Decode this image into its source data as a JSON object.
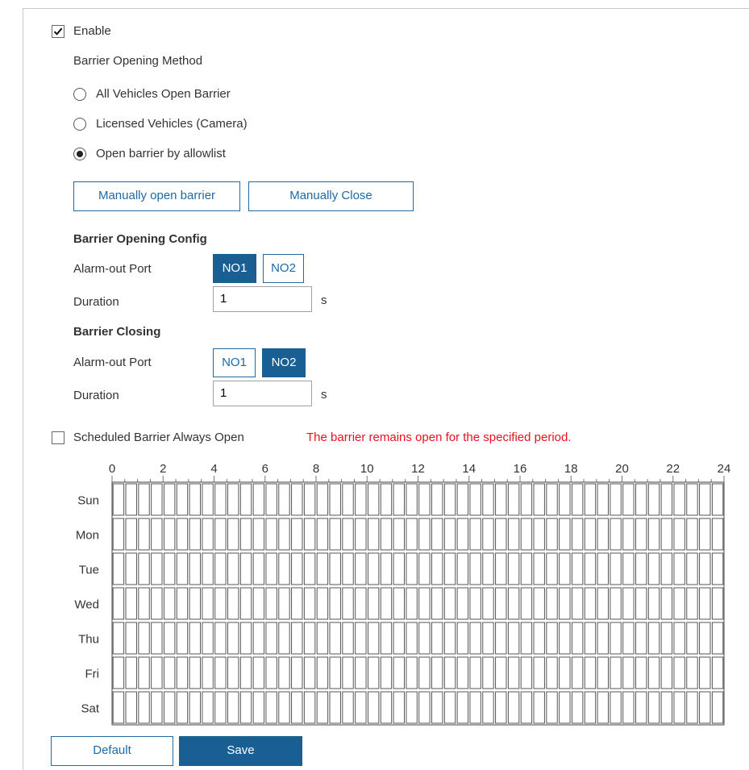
{
  "enable": {
    "label": "Enable",
    "checked": true
  },
  "opening_method": {
    "title": "Barrier Opening Method",
    "options": [
      {
        "label": "All Vehicles Open Barrier",
        "selected": false
      },
      {
        "label": "Licensed Vehicles (Camera)",
        "selected": false
      },
      {
        "label": "Open barrier by allowlist",
        "selected": true
      }
    ]
  },
  "manual_buttons": {
    "open": "Manually open barrier",
    "close": "Manually Close"
  },
  "opening_config": {
    "title": "Barrier Opening Config",
    "port_label": "Alarm-out Port",
    "ports": [
      "NO1",
      "NO2"
    ],
    "active_port": "NO1",
    "duration_label": "Duration",
    "duration_value": "1",
    "duration_unit": "s"
  },
  "closing_config": {
    "title": "Barrier Closing",
    "port_label": "Alarm-out Port",
    "ports": [
      "NO1",
      "NO2"
    ],
    "active_port": "NO2",
    "duration_label": "Duration",
    "duration_value": "1",
    "duration_unit": "s"
  },
  "schedule": {
    "label": "Scheduled Barrier Always Open",
    "checked": false,
    "note": "The barrier remains open for the specified period.",
    "hour_labels": [
      "0",
      "2",
      "4",
      "6",
      "8",
      "10",
      "12",
      "14",
      "16",
      "18",
      "20",
      "22",
      "24"
    ],
    "days": [
      "Sun",
      "Mon",
      "Tue",
      "Wed",
      "Thu",
      "Fri",
      "Sat"
    ],
    "slots_per_day": 48
  },
  "footer": {
    "default_label": "Default",
    "save_label": "Save"
  },
  "colors": {
    "accent": "#1a5f94",
    "warning": "#e8121e",
    "grid_line": "#c8c8c8"
  }
}
